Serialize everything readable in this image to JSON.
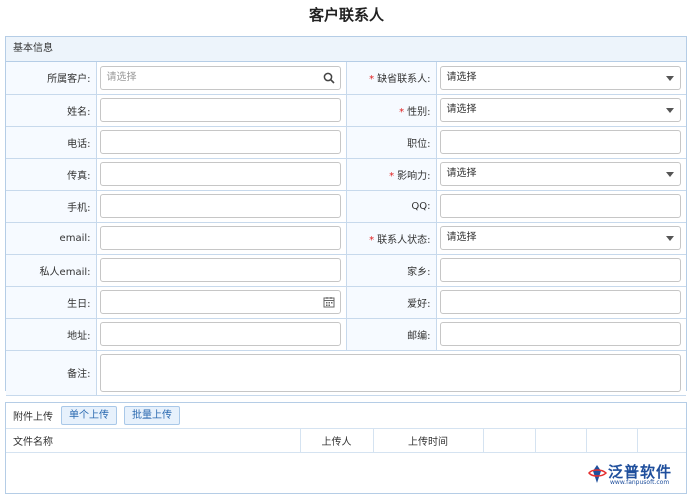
{
  "page": {
    "title": "客户联系人"
  },
  "basic_info": {
    "header": "基本信息",
    "rows": [
      {
        "l_label": "所属客户:",
        "l_required": false,
        "l_type": "search",
        "l_value": "请选择",
        "r_label": "缺省联系人:",
        "r_required": true,
        "r_type": "select",
        "r_value": "请选择"
      },
      {
        "l_label": "姓名:",
        "l_required": false,
        "l_type": "text",
        "l_value": "",
        "r_label": "性别:",
        "r_required": true,
        "r_type": "select",
        "r_value": "请选择"
      },
      {
        "l_label": "电话:",
        "l_required": false,
        "l_type": "text",
        "l_value": "",
        "r_label": "职位:",
        "r_required": false,
        "r_type": "text",
        "r_value": ""
      },
      {
        "l_label": "传真:",
        "l_required": false,
        "l_type": "text",
        "l_value": "",
        "r_label": "影响力:",
        "r_required": true,
        "r_type": "select",
        "r_value": "请选择"
      },
      {
        "l_label": "手机:",
        "l_required": false,
        "l_type": "text",
        "l_value": "",
        "r_label": "QQ:",
        "r_required": false,
        "r_type": "text",
        "r_value": ""
      },
      {
        "l_label": "email:",
        "l_required": false,
        "l_type": "text",
        "l_value": "",
        "r_label": "联系人状态:",
        "r_required": true,
        "r_type": "select",
        "r_value": "请选择"
      },
      {
        "l_label": "私人email:",
        "l_required": false,
        "l_type": "text",
        "l_value": "",
        "r_label": "家乡:",
        "r_required": false,
        "r_type": "text",
        "r_value": ""
      },
      {
        "l_label": "生日:",
        "l_required": false,
        "l_type": "date",
        "l_value": "",
        "r_label": "爱好:",
        "r_required": false,
        "r_type": "text",
        "r_value": ""
      },
      {
        "l_label": "地址:",
        "l_required": false,
        "l_type": "text",
        "l_value": "",
        "r_label": "邮编:",
        "r_required": false,
        "r_type": "text",
        "r_value": ""
      }
    ],
    "remark": {
      "label": "备注:",
      "value": ""
    }
  },
  "attachments": {
    "title": "附件上传",
    "single_upload": "单个上传",
    "batch_upload": "批量上传",
    "columns": [
      "文件名称",
      "上传人",
      "上传时间",
      "",
      "",
      "",
      ""
    ]
  },
  "logo": {
    "text": "泛普软件",
    "url": "www.fanpusoft.com"
  },
  "colors": {
    "border": "#b5cde6",
    "label_bg": "#f6faff",
    "required": "#e02020",
    "button_text": "#2a69b0"
  },
  "icons": {
    "search": "search-icon",
    "calendar": "calendar-icon",
    "dropdown": "chevron-down-icon"
  }
}
